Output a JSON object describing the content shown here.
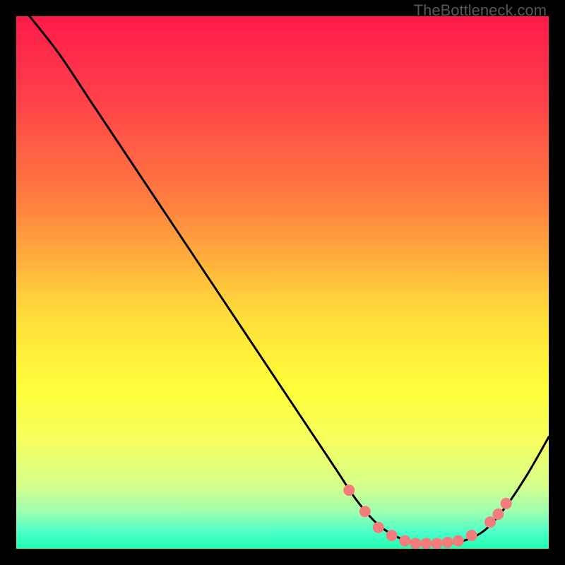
{
  "watermark": "TheBottleneck.com",
  "chart_data": {
    "type": "line",
    "title": "",
    "xlabel": "",
    "ylabel": "",
    "xlim": [
      0,
      100
    ],
    "ylim": [
      0,
      100
    ],
    "gradient_stops": [
      {
        "offset": 0.0,
        "color": "#ff1a4a"
      },
      {
        "offset": 0.15,
        "color": "#ff3f4a"
      },
      {
        "offset": 0.35,
        "color": "#ff7f3f"
      },
      {
        "offset": 0.55,
        "color": "#ffd93a"
      },
      {
        "offset": 0.7,
        "color": "#ffff3a"
      },
      {
        "offset": 0.8,
        "color": "#f5ff60"
      },
      {
        "offset": 0.88,
        "color": "#d6ff8a"
      },
      {
        "offset": 0.93,
        "color": "#9fffb0"
      },
      {
        "offset": 0.97,
        "color": "#4affc9"
      },
      {
        "offset": 1.0,
        "color": "#1fffb0"
      }
    ],
    "curve": [
      {
        "x": 2.5,
        "y": 100.0
      },
      {
        "x": 8.0,
        "y": 93.0
      },
      {
        "x": 14.0,
        "y": 84.0
      },
      {
        "x": 22.0,
        "y": 72.0
      },
      {
        "x": 30.0,
        "y": 60.0
      },
      {
        "x": 38.0,
        "y": 48.0
      },
      {
        "x": 46.0,
        "y": 36.0
      },
      {
        "x": 54.0,
        "y": 24.0
      },
      {
        "x": 60.0,
        "y": 15.0
      },
      {
        "x": 64.0,
        "y": 9.0
      },
      {
        "x": 68.0,
        "y": 4.5
      },
      {
        "x": 72.0,
        "y": 2.0
      },
      {
        "x": 76.0,
        "y": 1.0
      },
      {
        "x": 80.0,
        "y": 1.0
      },
      {
        "x": 84.0,
        "y": 1.5
      },
      {
        "x": 88.0,
        "y": 3.5
      },
      {
        "x": 92.0,
        "y": 8.0
      },
      {
        "x": 96.0,
        "y": 14.0
      },
      {
        "x": 100.0,
        "y": 21.0
      }
    ],
    "markers": [
      {
        "x": 62.5,
        "y": 11.0
      },
      {
        "x": 65.5,
        "y": 7.0
      },
      {
        "x": 68.0,
        "y": 4.0
      },
      {
        "x": 70.5,
        "y": 2.5
      },
      {
        "x": 73.0,
        "y": 1.5
      },
      {
        "x": 75.0,
        "y": 1.0
      },
      {
        "x": 77.0,
        "y": 1.0
      },
      {
        "x": 79.0,
        "y": 1.0
      },
      {
        "x": 81.0,
        "y": 1.2
      },
      {
        "x": 83.0,
        "y": 1.5
      },
      {
        "x": 85.5,
        "y": 2.5
      },
      {
        "x": 89.0,
        "y": 5.0
      },
      {
        "x": 90.5,
        "y": 6.5
      },
      {
        "x": 92.0,
        "y": 8.5
      }
    ],
    "marker_color": "#f47c7c",
    "curve_color": "#000000"
  }
}
